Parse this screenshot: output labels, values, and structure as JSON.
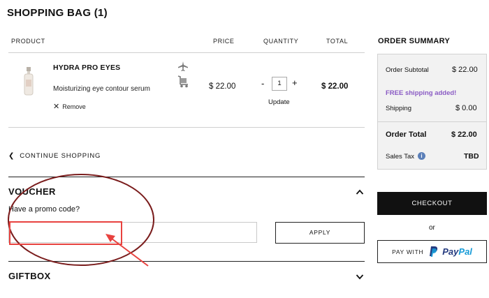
{
  "page": {
    "title": "SHOPPING BAG (1)"
  },
  "columns": {
    "product": "PRODUCT",
    "price": "PRICE",
    "quantity": "QUANTITY",
    "total": "TOTAL"
  },
  "item": {
    "name": "HYDRA PRO EYES",
    "description": "Moisturizing eye contour serum",
    "remove_label": "Remove",
    "remove_icon": "close-icon",
    "price": "$ 22.00",
    "quantity": "1",
    "minus": "-",
    "plus": "+",
    "update_label": "Update",
    "total": "$ 22.00",
    "shipping_icons": [
      "airplane-icon",
      "hand-truck-icon"
    ]
  },
  "continue_shopping": "CONTINUE SHOPPING",
  "voucher": {
    "title": "VOUCHER",
    "promo_label": "Have a promo code?",
    "input_value": "",
    "apply_label": "APPLY"
  },
  "giftbox": {
    "title": "GIFTBOX"
  },
  "summary": {
    "title": "ORDER SUMMARY",
    "subtotal_label": "Order Subtotal",
    "subtotal_value": "$ 22.00",
    "free_shipping": "FREE shipping added!",
    "shipping_label": "Shipping",
    "shipping_value": "$ 0.00",
    "total_label": "Order Total",
    "total_value": "$ 22.00",
    "tax_label": "Sales Tax",
    "tax_value": "TBD",
    "info_glyph": "i"
  },
  "checkout": {
    "checkout_label": "CHECKOUT",
    "or_label": "or",
    "paypal_prefix": "PAY WITH",
    "paypal_pay": "Pay",
    "paypal_pal": "Pal"
  },
  "annotation": {
    "highlight_color": "#e8423f",
    "ellipse_color": "#7a1c1c"
  }
}
